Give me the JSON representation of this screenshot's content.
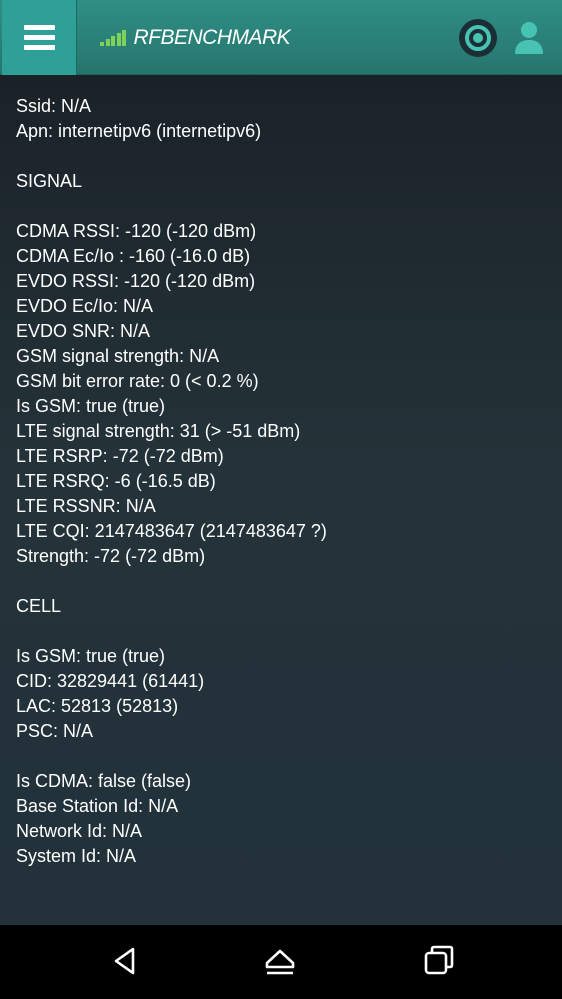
{
  "app": {
    "brand": "RFBENCHMARK"
  },
  "lines": [
    "Ssid: N/A",
    "Apn: internetipv6 (internetipv6)",
    "",
    "SIGNAL",
    "",
    "CDMA RSSI: -120 (-120 dBm)",
    "CDMA Ec/Io : -160 (-16.0 dB)",
    "EVDO RSSI: -120 (-120 dBm)",
    "EVDO Ec/Io: N/A",
    "EVDO SNR: N/A",
    "GSM signal strength: N/A",
    "GSM bit error rate: 0 (< 0.2 %)",
    "Is GSM: true (true)",
    "LTE signal strength: 31 (> -51 dBm)",
    "LTE RSRP: -72 (-72 dBm)",
    "LTE RSRQ: -6 (-16.5 dB)",
    "LTE RSSNR: N/A",
    "LTE CQI: 2147483647 (2147483647 ?)",
    "Strength: -72 (-72 dBm)",
    "",
    "CELL",
    "",
    "Is GSM: true (true)",
    "CID: 32829441 (61441)",
    "LAC: 52813 (52813)",
    "PSC: N/A",
    "",
    "Is CDMA: false (false)",
    "Base Station Id: N/A",
    "Network Id: N/A",
    "System Id: N/A"
  ],
  "colors": {
    "appbar": "#2a8279",
    "accent": "#47c2b3",
    "signal_bars": "#7fd35a",
    "text": "#ffffff"
  },
  "icons": {
    "menu": "hamburger-menu-icon",
    "logo": "signal-bars-icon",
    "target": "target-icon",
    "user": "user-icon",
    "back": "back-icon",
    "home": "home-icon",
    "recents": "recents-icon"
  }
}
